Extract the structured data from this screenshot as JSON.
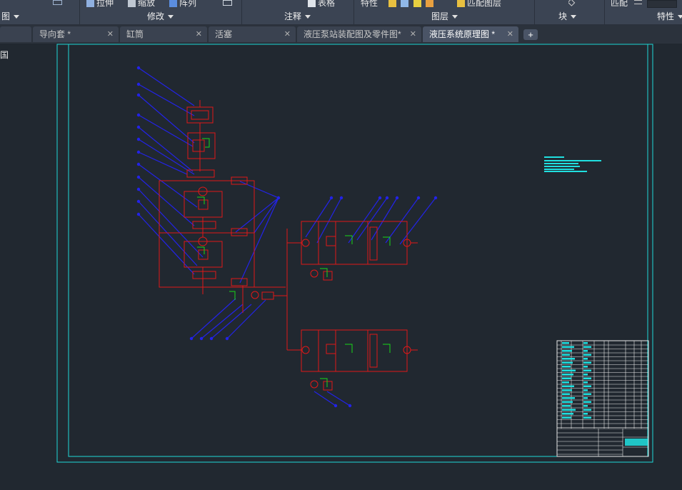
{
  "ribbon": {
    "top_items": [
      {
        "label": "拉伸",
        "icon": "stretch-icon"
      },
      {
        "label": "缩放",
        "icon": "scale-icon"
      },
      {
        "label": "阵列",
        "icon": "array-icon"
      },
      {
        "label": "表格",
        "icon": "table-icon"
      },
      {
        "label": "特性",
        "icon": ""
      },
      {
        "label": "匹配图层",
        "icon": "match-layer-icon"
      },
      {
        "label": "匹配",
        "icon": ""
      }
    ],
    "panels": [
      "图",
      "修改",
      "注释",
      "图层",
      "块",
      "特性"
    ]
  },
  "tabs": [
    {
      "label": "导向套 *",
      "active": false
    },
    {
      "label": "缸筒",
      "active": false
    },
    {
      "label": "活塞",
      "active": false
    },
    {
      "label": "液压泵站装配图及零件图*",
      "active": false
    },
    {
      "label": "液压系统原理图 *",
      "active": true
    }
  ],
  "new_tab_label": "+",
  "side_label": "国",
  "colors": {
    "background": "#212830",
    "frame": "#1fd8d8",
    "circuit": "#e01818",
    "leader": "#1a1ae0",
    "green": "#18d818",
    "text": "#20e0e0"
  }
}
